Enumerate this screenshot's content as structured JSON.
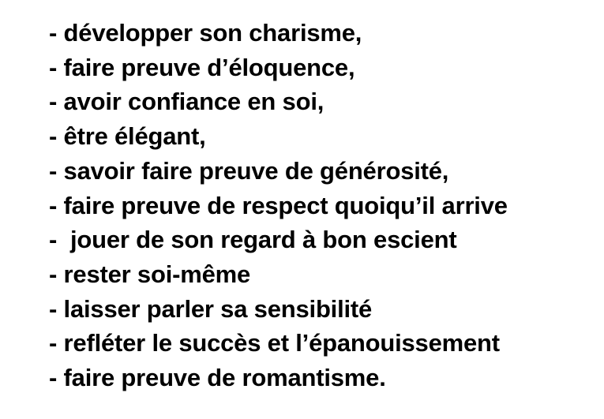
{
  "lines": [
    "- développer son charisme,",
    "- faire preuve d’éloquence,",
    "- avoir confiance en soi,",
    "- être élégant,",
    "- savoir faire preuve de générosité,",
    "- faire preuve de respect quoiqu’il arrive",
    "-  jouer de son regard à bon escient",
    "- rester soi-même",
    "- laisser parler sa sensibilité",
    "- refléter le succès et l’épanouissement",
    "- faire preuve de romantisme."
  ]
}
